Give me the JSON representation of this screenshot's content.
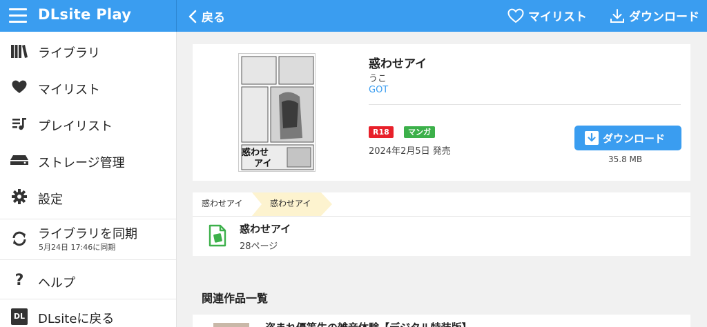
{
  "app": {
    "logo": "DLsite Play"
  },
  "header": {
    "back_label": "戻る",
    "mylist_label": "マイリスト",
    "download_label": "ダウンロード"
  },
  "sidebar": {
    "items": [
      {
        "label": "ライブラリ",
        "icon": "library-icon"
      },
      {
        "label": "マイリスト",
        "icon": "heart-icon"
      },
      {
        "label": "プレイリスト",
        "icon": "playlist-icon"
      },
      {
        "label": "ストレージ管理",
        "icon": "storage-icon"
      },
      {
        "label": "設定",
        "icon": "gear-icon"
      },
      {
        "label": "ライブラリを同期",
        "sub": "5月24日 17:46に同期",
        "icon": "sync-icon"
      },
      {
        "label": "ヘルプ",
        "icon": "help-icon"
      },
      {
        "label": "DLsiteに戻る",
        "icon": "dl-icon"
      }
    ]
  },
  "work": {
    "title": "惑わせアイ",
    "author": "うこ",
    "circle": "GOT",
    "badges": [
      {
        "label": "R18",
        "color": "#e8202a"
      },
      {
        "label": "マンガ",
        "color": "#3cb04a"
      }
    ],
    "release": "2024年2月5日 発売",
    "download_label": "ダウンロード",
    "size": "35.8 MB",
    "cover_text_1": "惑わせ",
    "cover_text_2": "アイ"
  },
  "breadcrumb": {
    "item1": "惑わせアイ",
    "item2": "惑わせアイ"
  },
  "volume": {
    "title": "惑わせアイ",
    "pages": "28ページ"
  },
  "related": {
    "heading": "関連作品一覧",
    "first_title": "盗まれ優等生の雑音体験【デジタル特装版】"
  },
  "colors": {
    "accent": "#3a9df0",
    "crumb_active": "#fdf3cf",
    "doc_green": "#3cb04a"
  }
}
